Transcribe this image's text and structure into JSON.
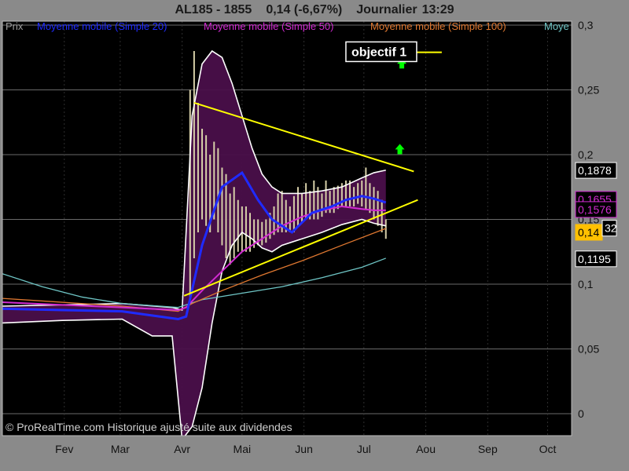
{
  "header": {
    "symbol": "AL185 - 1855",
    "last": "0,14 (-6,67%)",
    "period": "Journalier",
    "time": "13:29"
  },
  "legend": [
    "Prix",
    "Moyenne mobile (Simple 20)",
    "Moyenne mobile (Simple 50)",
    "Moyenne mobile (Simple 100)",
    "Moye"
  ],
  "watermark": "© ProRealTime.com Historique ajusté suite aux dividendes",
  "annotations": {
    "target_label": "objectif 1"
  },
  "price_labels": [
    {
      "text": "0,1878",
      "value": 0.1878
    },
    {
      "text": "0,1655",
      "value": 0.1655
    },
    {
      "text": "0,1576",
      "value": 0.1576
    },
    {
      "text": "0,14",
      "value": 0.14
    },
    {
      "text": "32",
      "value": 0.1432
    },
    {
      "text": "0,1195",
      "value": 0.1195
    }
  ],
  "colors": {
    "background": "#000000",
    "panel": "#8a8a8a",
    "bollinger_fill": "#4a0f4a",
    "bollinger_band": "#ffffff",
    "price_bar": "#d6cfa8",
    "sma20": "#1f2bff",
    "sma50": "#d22bd2",
    "sma100": "#e07830",
    "sma_long": "#6fc6c6",
    "trendline": "#ffff00",
    "arrow": "#00ff00",
    "last_price_bg": "#ffc000"
  },
  "chart_data": {
    "type": "line",
    "y_axis_ticks": [
      "0",
      "0,05",
      "0,1",
      "0,15",
      "0,2",
      "0,25",
      "0,3"
    ],
    "y_axis_values": [
      0,
      0.05,
      0.1,
      0.15,
      0.2,
      0.25,
      0.3
    ],
    "ylim": [
      -0.017,
      0.303
    ],
    "x_axis_ticks": [
      "Fev",
      "Mar",
      "Avr",
      "Mai",
      "Jun",
      "Jul",
      "Aou",
      "Sep",
      "Oct"
    ],
    "x_axis_day_index": [
      31,
      59,
      90,
      120,
      151,
      181,
      212,
      243,
      273
    ],
    "x_range_days": [
      0,
      285
    ],
    "grid": true,
    "series": [
      {
        "name": "Moyenne mobile (Simple 20)",
        "key": "sma20",
        "x": [
          0,
          30,
          60,
          88,
          92,
          100,
          110,
          120,
          128,
          135,
          145,
          155,
          165,
          172,
          180,
          186,
          192
        ],
        "y": [
          0.081,
          0.08,
          0.079,
          0.073,
          0.075,
          0.13,
          0.175,
          0.186,
          0.165,
          0.15,
          0.14,
          0.155,
          0.16,
          0.165,
          0.168,
          0.166,
          0.163
        ]
      },
      {
        "name": "Moyenne mobile (Simple 50)",
        "key": "sma50",
        "x": [
          0,
          30,
          60,
          88,
          92,
          100,
          110,
          120,
          130,
          140,
          150,
          160,
          170,
          180,
          186,
          192
        ],
        "y": [
          0.086,
          0.084,
          0.082,
          0.08,
          0.082,
          0.095,
          0.11,
          0.125,
          0.135,
          0.145,
          0.152,
          0.157,
          0.16,
          0.158,
          0.157,
          0.157
        ]
      },
      {
        "name": "Moyenne mobile (Simple 100)",
        "key": "sma100",
        "x": [
          0,
          30,
          60,
          88,
          95,
          110,
          130,
          150,
          170,
          192
        ],
        "y": [
          0.089,
          0.086,
          0.083,
          0.079,
          0.085,
          0.095,
          0.107,
          0.118,
          0.13,
          0.143
        ]
      },
      {
        "name": "Moye",
        "key": "sma_long",
        "x": [
          0,
          20,
          40,
          60,
          88,
          100,
          120,
          140,
          160,
          180,
          192
        ],
        "y": [
          0.108,
          0.098,
          0.09,
          0.085,
          0.082,
          0.088,
          0.093,
          0.098,
          0.105,
          0.113,
          0.12
        ]
      },
      {
        "name": "upper band",
        "key": "bb_upper",
        "x": [
          0,
          30,
          60,
          85,
          90,
          95,
          100,
          105,
          110,
          115,
          120,
          125,
          130,
          135,
          140,
          150,
          160,
          170,
          180,
          186,
          192
        ],
        "y": [
          0.083,
          0.084,
          0.085,
          0.082,
          0.08,
          0.23,
          0.27,
          0.28,
          0.275,
          0.255,
          0.23,
          0.205,
          0.185,
          0.175,
          0.17,
          0.17,
          0.172,
          0.175,
          0.182,
          0.186,
          0.188
        ]
      },
      {
        "name": "lower band",
        "key": "bb_lower",
        "x": [
          0,
          30,
          60,
          75,
          85,
          90,
          95,
          100,
          105,
          110,
          115,
          120,
          125,
          130,
          135,
          140,
          150,
          160,
          170,
          180,
          186,
          192
        ],
        "y": [
          0.07,
          0.072,
          0.073,
          0.06,
          0.06,
          -0.02,
          -0.01,
          0.02,
          0.07,
          0.11,
          0.13,
          0.14,
          0.135,
          0.128,
          0.125,
          0.13,
          0.135,
          0.14,
          0.146,
          0.15,
          0.147,
          0.145
        ]
      }
    ],
    "trendlines": [
      {
        "x": [
          96,
          206
        ],
        "y": [
          0.24,
          0.187
        ]
      },
      {
        "x": [
          91,
          208
        ],
        "y": [
          0.091,
          0.165
        ]
      },
      {
        "x": [
          196,
          220
        ],
        "y": [
          0.279,
          0.279
        ]
      }
    ],
    "price_bars": {
      "x": [
        94,
        96,
        98,
        100,
        102,
        104,
        106,
        108,
        110,
        112,
        114,
        116,
        118,
        120,
        122,
        124,
        126,
        128,
        130,
        132,
        134,
        136,
        138,
        140,
        142,
        144,
        146,
        148,
        150,
        152,
        154,
        156,
        158,
        160,
        162,
        164,
        166,
        168,
        170,
        172,
        174,
        176,
        178,
        180,
        182,
        184,
        186,
        188,
        190,
        192
      ],
      "high": [
        0.25,
        0.28,
        0.24,
        0.22,
        0.215,
        0.2,
        0.21,
        0.205,
        0.19,
        0.185,
        0.17,
        0.175,
        0.165,
        0.16,
        0.16,
        0.155,
        0.15,
        0.15,
        0.148,
        0.15,
        0.155,
        0.16,
        0.17,
        0.172,
        0.165,
        0.16,
        0.168,
        0.175,
        0.17,
        0.178,
        0.172,
        0.18,
        0.175,
        0.17,
        0.18,
        0.172,
        0.175,
        0.176,
        0.178,
        0.18,
        0.18,
        0.175,
        0.178,
        0.18,
        0.19,
        0.178,
        0.175,
        0.172,
        0.165,
        0.15
      ],
      "low": [
        0.09,
        0.12,
        0.14,
        0.15,
        0.145,
        0.14,
        0.15,
        0.14,
        0.13,
        0.12,
        0.115,
        0.12,
        0.125,
        0.125,
        0.125,
        0.125,
        0.128,
        0.13,
        0.13,
        0.132,
        0.135,
        0.138,
        0.14,
        0.14,
        0.14,
        0.14,
        0.14,
        0.145,
        0.148,
        0.15,
        0.15,
        0.15,
        0.15,
        0.152,
        0.155,
        0.155,
        0.155,
        0.158,
        0.16,
        0.16,
        0.16,
        0.16,
        0.162,
        0.16,
        0.158,
        0.155,
        0.15,
        0.145,
        0.14,
        0.135
      ]
    }
  }
}
